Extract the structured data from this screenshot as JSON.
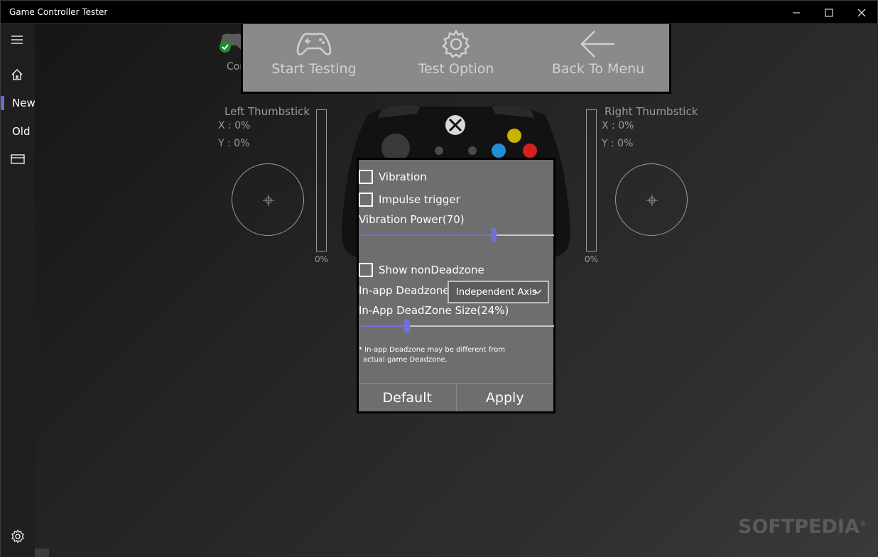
{
  "window": {
    "title": "Game Controller Tester",
    "minimize_icon": "minimize-icon",
    "maximize_icon": "maximize-icon",
    "close_icon": "close-icon"
  },
  "sidebar": {
    "menu_icon": "hamburger-icon",
    "home_icon": "home-icon",
    "items": [
      {
        "label": "New",
        "active": true
      },
      {
        "label": "Old",
        "active": false
      }
    ],
    "card_icon": "card-icon",
    "settings_icon": "gear-icon"
  },
  "header": {
    "controller_status_text": "Con",
    "toolbar": {
      "start": "Start Testing",
      "option": "Test Option",
      "back": "Back To Menu"
    }
  },
  "left_stick": {
    "title": "Left Thumbstick",
    "x": "X : 0%",
    "y": "Y : 0%",
    "trigger": "0%"
  },
  "right_stick": {
    "title": "Right Thumbstick",
    "x": "X : 0%",
    "y": "Y : 0%",
    "trigger": "0%"
  },
  "options": {
    "vibration": {
      "label": "Vibration",
      "checked": false
    },
    "impulse": {
      "label": "Impulse trigger",
      "checked": false
    },
    "vibration_power": {
      "label": "Vibration Power(70)",
      "value": 70
    },
    "show_non_deadzone": {
      "label": "Show nonDeadzone",
      "checked": false
    },
    "deadzone_mode": {
      "label": "In-app Deadzone",
      "selected": "Independent Axis"
    },
    "deadzone_size": {
      "label": "In-App DeadZone Size(24%)",
      "value": 24
    },
    "note_line1": "* In-app Deadzone may be different from",
    "note_line2": "actual game Deadzone.",
    "default_button": "Default",
    "apply_button": "Apply"
  },
  "colors": {
    "accent": "#6b69d6",
    "button_y": "#c8b400",
    "button_x": "#1f8ed6",
    "button_b": "#d42020"
  },
  "watermark": "SOFTPEDIA"
}
